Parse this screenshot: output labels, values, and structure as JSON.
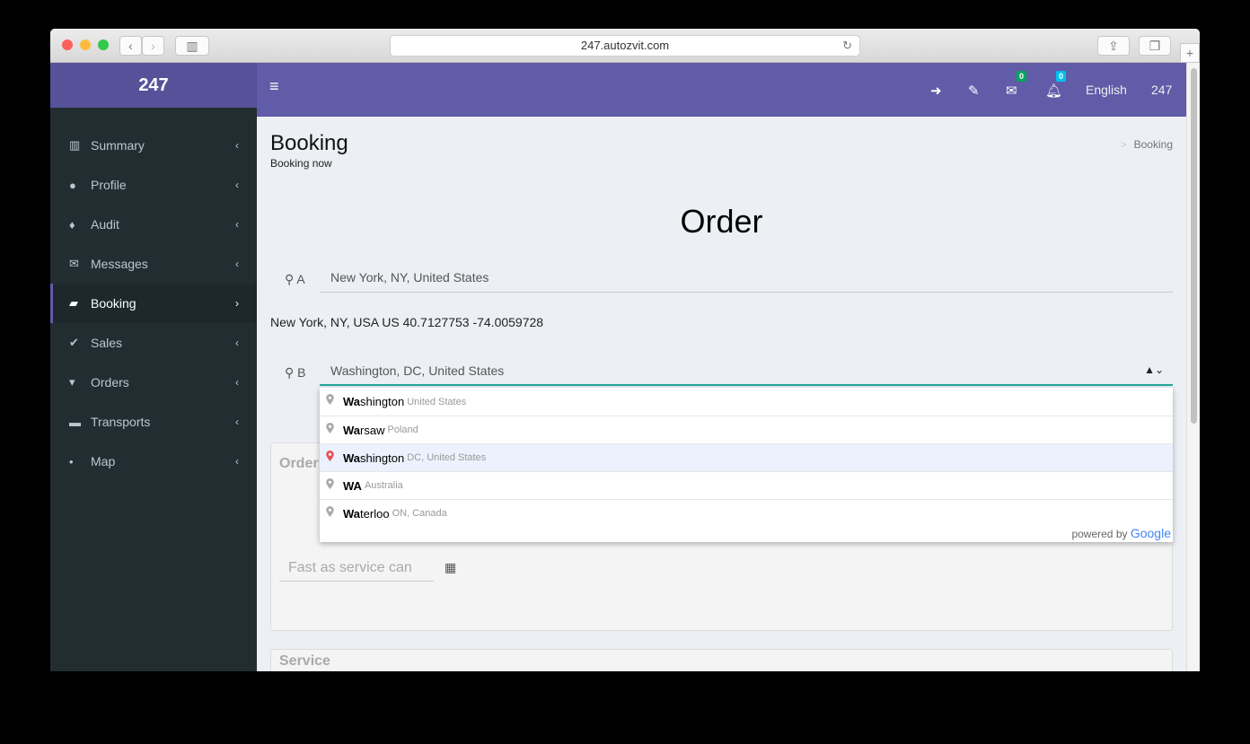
{
  "browser": {
    "url": "247.autozvit.com"
  },
  "sidebar": {
    "brand": "247",
    "items": [
      {
        "label": "Summary",
        "icon": "bar-chart-icon"
      },
      {
        "label": "Profile",
        "icon": "user-icon"
      },
      {
        "label": "Audit",
        "icon": "bell-icon"
      },
      {
        "label": "Messages",
        "icon": "envelope-icon"
      },
      {
        "label": "Booking",
        "icon": "book-icon",
        "active": true
      },
      {
        "label": "Sales",
        "icon": "check-icon"
      },
      {
        "label": "Orders",
        "icon": "cart-icon"
      },
      {
        "label": "Transports",
        "icon": "car-icon"
      },
      {
        "label": "Map",
        "icon": "map-pin-icon"
      }
    ]
  },
  "header": {
    "messages_count": "0",
    "notifications_count": "0",
    "language": "English",
    "user": "247",
    "colors": {
      "header": "#605ca8",
      "brand": "#555299",
      "msg_badge": "#00a65a",
      "notif_badge": "#00c0ef"
    }
  },
  "page": {
    "title": "Booking",
    "subtitle": "Booking now",
    "breadcrumb": "Booking",
    "heading": "Order"
  },
  "form": {
    "point_a_label": "A",
    "point_a_value": "New York, NY, United States",
    "point_a_info": "New York, NY, USA US 40.7127753 -74.0059728",
    "point_b_label": "B",
    "point_b_value": "Washington, DC, United States",
    "date_placeholder": "Fast as service can",
    "order_box_title": "Order",
    "service_box_title": "Service"
  },
  "autocomplete": {
    "items": [
      {
        "match": "Wa",
        "rest": "shington",
        "secondary": "United States"
      },
      {
        "match": "Wa",
        "rest": "rsaw",
        "secondary": "Poland"
      },
      {
        "match": "Wa",
        "rest": "shington",
        "secondary": "DC, United States",
        "selected": true
      },
      {
        "match": "WA",
        "rest": "",
        "secondary": "Australia"
      },
      {
        "match": "Wa",
        "rest": "terloo",
        "secondary": "ON, Canada"
      }
    ],
    "powered_by": "powered by",
    "google": "Google"
  }
}
